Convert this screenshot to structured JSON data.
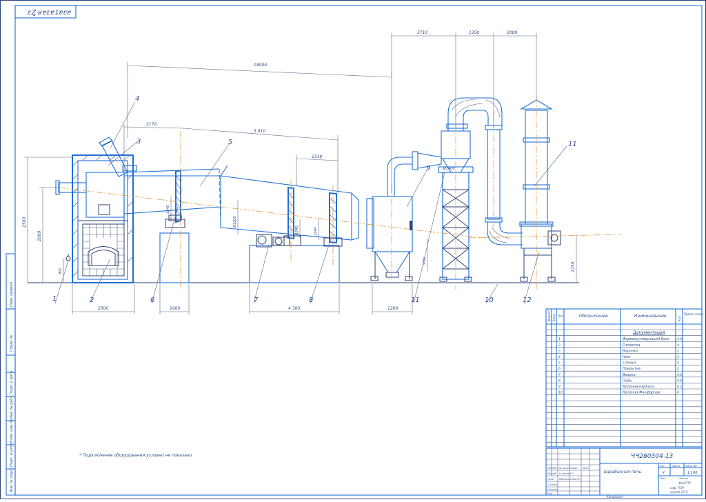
{
  "sheet": {
    "stamp_code": "ɛȤ ʁɐɛɐ1ɐɛɐ",
    "drawing_code": "ЧЧ260304-13",
    "drawing_title": "Барабанная печь",
    "note": "* Подключение оборудования условно не показано",
    "sheet_scale": "1:100",
    "sheet_lit": "У",
    "bottom_label": "Копировал"
  },
  "side_strip": [
    "Перв. примен.",
    "Справ. №",
    "Подп. и дата",
    "Инв. № дубл.",
    "Взам. инв. №",
    "Подп. и дата",
    "Инв. № подл."
  ],
  "callouts": [
    "1",
    "2",
    "3",
    "4",
    "5",
    "6",
    "7",
    "8",
    "9",
    "10",
    "11",
    "12"
  ],
  "dimensions": {
    "d_18000": "18000",
    "d_2170": "2170",
    "d_5910": "5 910",
    "d_1510": "1510",
    "d_3710": "3710",
    "d_1350": "1350",
    "d_2080": "2080",
    "d_2500h": "2500",
    "d_2000h": "2000",
    "d_800": "800",
    "d_2500w": "2500",
    "d_1000a": "1000",
    "d_4300": "4 300",
    "d_1200": "1200",
    "d_1240": "1240",
    "d_1200d": "Ø1200",
    "d_1245": "1245",
    "d_1240b": "1240",
    "d_1400": "Ø1400",
    "d_3000": "3000",
    "d_2250": "2250"
  },
  "bom": {
    "headers": {
      "format": "Формат",
      "zone": "Зона",
      "pos": "Поз.",
      "designation": "Обозначение",
      "name": "Наименование",
      "qty": "Кол.",
      "note": "Приме-чание"
    },
    "section": "Документация",
    "rows": [
      {
        "pos": "1",
        "name": "Форвакуумирующий Бокс",
        "qty": "4.8"
      },
      {
        "pos": "2",
        "name": "Отмостка",
        "qty": "4"
      },
      {
        "pos": "3",
        "name": "Воронка",
        "qty": "2"
      },
      {
        "pos": "4",
        "name": "Нож",
        "qty": "3"
      },
      {
        "pos": "5",
        "name": "Стенки",
        "qty": "4"
      },
      {
        "pos": "6",
        "name": "Покрытие",
        "qty": "3"
      },
      {
        "pos": "7",
        "name": "Вхорка",
        "qty": "4.0"
      },
      {
        "pos": "8",
        "name": "Пазы",
        "qty": "4.6"
      },
      {
        "pos": "9",
        "name": "Колонна каркаса",
        "qty": "0.3"
      },
      {
        "pos": "10",
        "name": "Колонна Фанфарная",
        "qty": "4"
      }
    ]
  },
  "title_block": {
    "cols": [
      "Изм.",
      "Лист",
      "№ докум.",
      "Подп.",
      "Дата"
    ],
    "roles": [
      "Разраб.",
      "Пров.",
      "Т.контр.",
      "Н.контр.",
      "Утв."
    ],
    "names": [
      "Гусаков М.Г.",
      "Обнаровский М.Г."
    ],
    "lit_label": "Лит.",
    "mass_label": "Масса",
    "scale_label": "Масштаб",
    "sheet_label": "Лист",
    "sheets_label": "Листов",
    "org_lines": [
      "ВолгГТУ",
      "каф. ТСМ",
      "группа ХТ-4"
    ]
  }
}
